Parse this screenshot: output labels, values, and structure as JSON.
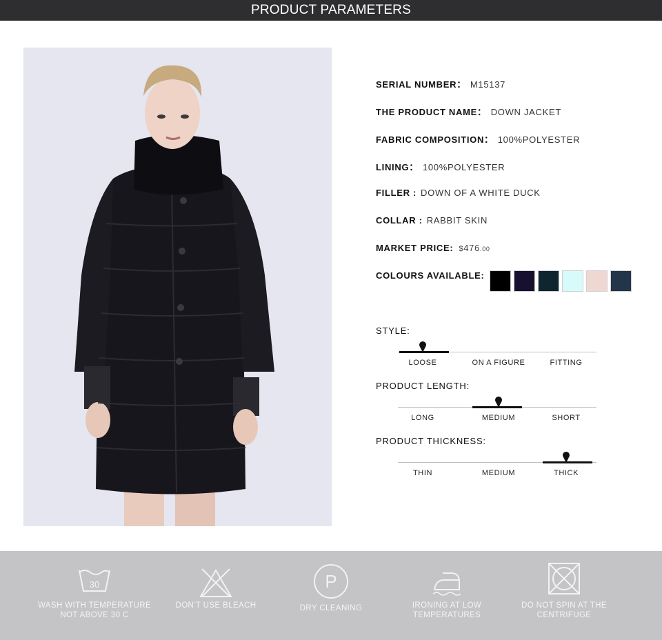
{
  "header": {
    "title": "PRODUCT PARAMETERS"
  },
  "params": {
    "serial_label": "SERIAL NUMBER：",
    "serial_value": "M15137",
    "name_label": "THE PRODUCT NAME：",
    "name_value": "DOWN JACKET",
    "fabric_label": "FABRIC COMPOSITION：",
    "fabric_value": "100%POLYESTER",
    "lining_label": "LINING：",
    "lining_value": "100%POLYESTER",
    "filler_label": "FILLER :",
    "filler_value": "DOWN OF A WHITE DUCK",
    "collar_label": "COLLAR :",
    "collar_value": "RABBIT SKIN",
    "price_label": "MARKET PRICE:",
    "price_symbol": "$",
    "price_value": "476",
    "price_cents": ".00",
    "colours_label": "COLOURS AVAILABLE:",
    "colours": [
      "#000000",
      "#17102e",
      "#0f2631",
      "#d6fbfa",
      "#f0d8d2",
      "#223549"
    ]
  },
  "style_scale": {
    "label": "STYLE:",
    "options": [
      "LOOSE",
      "ON A FIGURE",
      "FITTING"
    ],
    "selected_index": 0
  },
  "length_scale": {
    "label": "PRODUCT LENGTH:",
    "options": [
      "LONG",
      "MEDIUM",
      "SHORT"
    ],
    "selected_index": 1
  },
  "thickness_scale": {
    "label": "PRODUCT THICKNESS:",
    "options": [
      "THIN",
      "MEDIUM",
      "THICK"
    ],
    "selected_index": 2
  },
  "care": {
    "wash_number": "30",
    "items": [
      {
        "icon": "wash-30-icon",
        "line1": "WASH WITH TEMPERATURE",
        "line2": "NOT ABOVE 30 C"
      },
      {
        "icon": "no-bleach-icon",
        "line1": "DON'T USE BLEACH",
        "line2": ""
      },
      {
        "icon": "dry-clean-icon",
        "line1": "DRY CLEANING",
        "line2": "",
        "glyph": "P"
      },
      {
        "icon": "iron-low-icon",
        "line1": "IRONING AT LOW",
        "line2": "TEMPERATURES"
      },
      {
        "icon": "no-spin-icon",
        "line1": "DO NOT SPIN AT THE",
        "line2": "CENTRIFUGE"
      }
    ]
  }
}
